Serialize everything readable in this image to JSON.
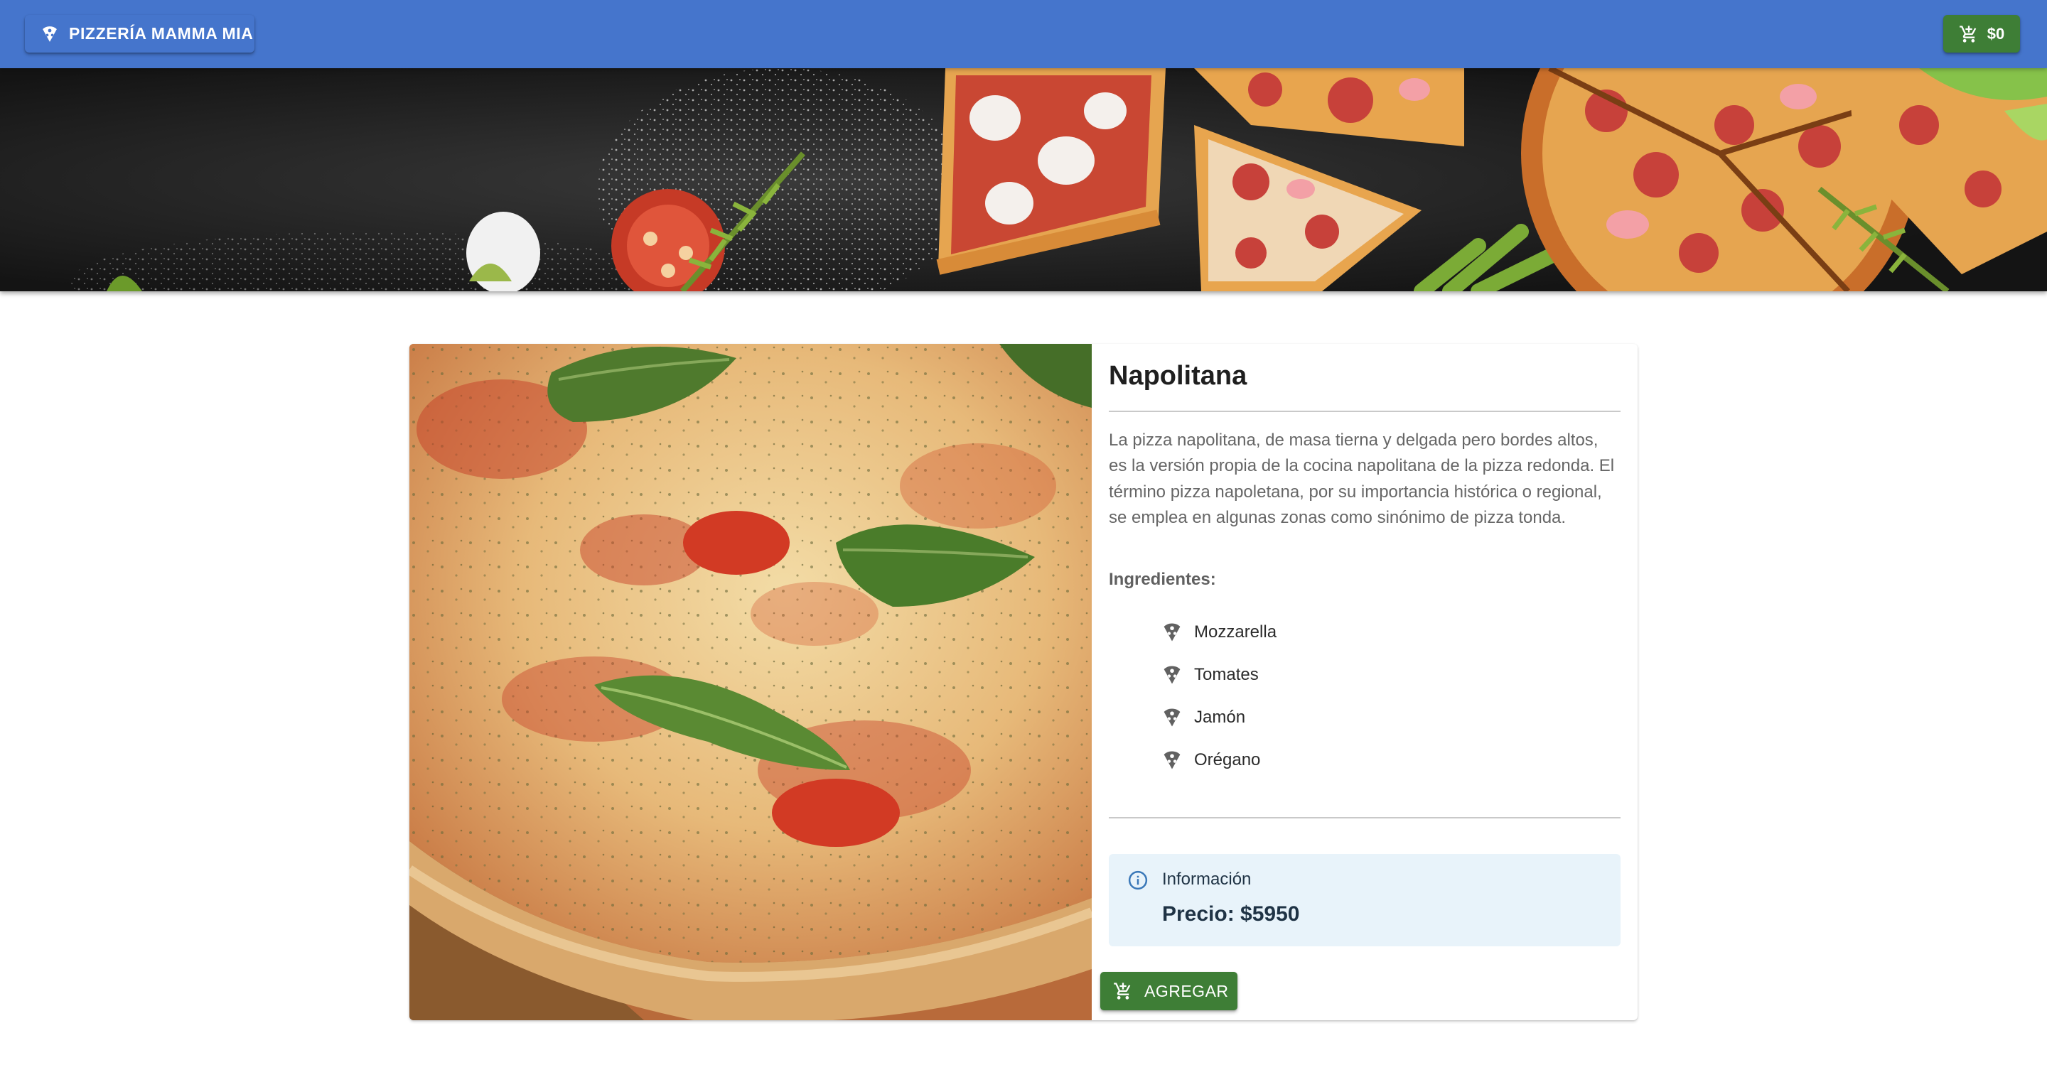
{
  "appbar": {
    "brand_label": "PIZZERÍA MAMMA MIA",
    "brand_icon": "pizza-slice-icon",
    "cart_total": "$0",
    "cart_icon": "cart-icon",
    "colors": {
      "bar": "#4575cc",
      "cart_button": "#3e7e36"
    }
  },
  "product": {
    "name": "Napolitana",
    "description": "La pizza napolitana, de masa tierna y delgada pero bordes altos, es la versión propia de la cocina napolitana de la pizza redonda. El término pizza napoletana, por su importancia histórica o regional, se emplea en algunas zonas como sinónimo de pizza tonda.",
    "ingredients_heading": "Ingredientes:",
    "ingredients": [
      "Mozzarella",
      "Tomates",
      "Jamón",
      "Orégano"
    ],
    "ingredient_icon": "pizza-slice-icon",
    "info": {
      "icon": "info-icon",
      "title": "Información",
      "price_text": "Precio: $5950"
    },
    "add_button_label": "AGREGAR",
    "add_button_icon": "cart-plus-icon",
    "colors": {
      "info_bg": "#e8f3fa",
      "add_button": "#3e7e36"
    }
  }
}
